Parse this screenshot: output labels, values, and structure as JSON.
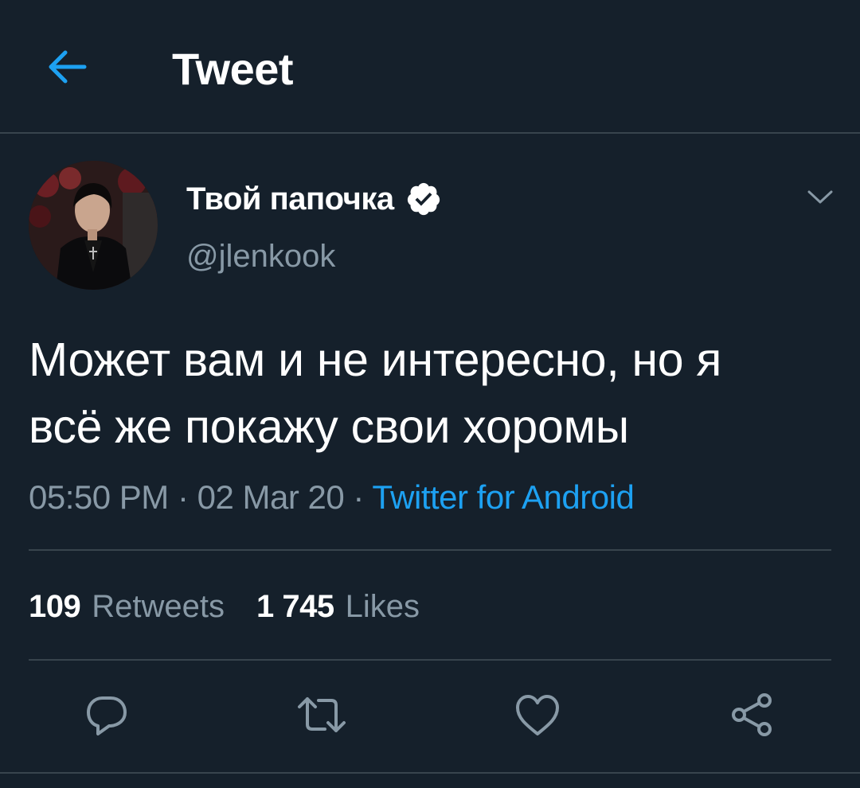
{
  "header": {
    "title": "Tweet",
    "back_icon": "arrow-left-icon"
  },
  "tweet": {
    "author": {
      "display_name": "Твой папочка",
      "handle": "@jlenkook",
      "verified": true
    },
    "text_line1": "Может вам и не интересно, но я",
    "text_line2": "всё же покажу свои хоромы",
    "time": "05:50 PM",
    "date": "02 Mar 20",
    "separator": "·",
    "source": "Twitter for Android",
    "stats": {
      "retweets_count": "109",
      "retweets_label": "Retweets",
      "likes_count": "1 745",
      "likes_label": "Likes"
    },
    "actions": [
      "reply-icon",
      "retweet-icon",
      "like-icon",
      "share-icon"
    ]
  },
  "colors": {
    "background": "#15202b",
    "accent": "#1da1f2",
    "secondary_text": "#8899a6",
    "divider": "#38444d"
  }
}
